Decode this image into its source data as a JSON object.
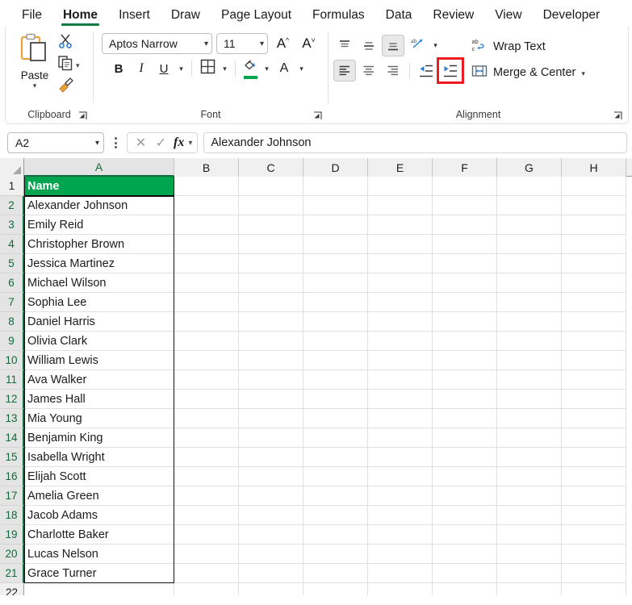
{
  "ribbon": {
    "tabs": [
      {
        "label": "File",
        "active": false
      },
      {
        "label": "Home",
        "active": true
      },
      {
        "label": "Insert",
        "active": false
      },
      {
        "label": "Draw",
        "active": false
      },
      {
        "label": "Page Layout",
        "active": false
      },
      {
        "label": "Formulas",
        "active": false
      },
      {
        "label": "Data",
        "active": false
      },
      {
        "label": "Review",
        "active": false
      },
      {
        "label": "View",
        "active": false
      },
      {
        "label": "Developer",
        "active": false
      }
    ],
    "clipboard": {
      "group_label": "Clipboard",
      "paste_label": "Paste",
      "cut_icon": "scissors-icon",
      "copy_icon": "copy-icon",
      "format_painter_icon": "paintbrush-icon",
      "dialog_launcher_icon": "dialog-launcher-icon"
    },
    "font": {
      "group_label": "Font",
      "font_name": "Aptos Narrow",
      "font_size": "11",
      "grow_font_label": "A",
      "shrink_font_label": "A",
      "bold_label": "B",
      "italic_label": "I",
      "underline_label": "U",
      "borders_icon": "borders-grid-icon",
      "fill_color_icon": "fill-color-icon",
      "fill_color_value": "#00A550",
      "font_color_label": "A",
      "font_color_value": "#c00000",
      "dialog_launcher_icon": "dialog-launcher-icon"
    },
    "alignment": {
      "group_label": "Alignment",
      "top_align": "align-top",
      "middle_align": "align-middle",
      "bottom_align": "align-bottom",
      "orientation_icon": "orientation-icon",
      "align_left": "align-left",
      "align_center": "align-center",
      "align_right": "align-right",
      "decrease_indent": "decrease-indent",
      "increase_indent": "increase-indent",
      "wrap_text_label": "Wrap Text",
      "merge_center_label": "Merge & Center",
      "highlight_color": "#ED1C24",
      "highlighted_button": "increase-indent",
      "selected_buttons": [
        "align-bottom",
        "align-left"
      ],
      "dialog_launcher_icon": "dialog-launcher-icon"
    }
  },
  "formula_bar": {
    "name_box_value": "A2",
    "cancel_icon": "cancel-x-icon",
    "confirm_icon": "confirm-check-icon",
    "fx_label": "fx",
    "formula_value": "Alexander Johnson"
  },
  "grid": {
    "columns": [
      "A",
      "B",
      "C",
      "D",
      "E",
      "F",
      "G",
      "H"
    ],
    "selected_column": "A",
    "rows": [
      "1",
      "2",
      "3",
      "4",
      "5",
      "6",
      "7",
      "8",
      "9",
      "10",
      "11",
      "12",
      "13",
      "14",
      "15",
      "16",
      "17",
      "18",
      "19",
      "20",
      "21",
      "22"
    ],
    "selected_rows": [
      "2",
      "3",
      "4",
      "5",
      "6",
      "7",
      "8",
      "9",
      "10",
      "11",
      "12",
      "13",
      "14",
      "15",
      "16",
      "17",
      "18",
      "19",
      "20",
      "21"
    ],
    "header_cell": {
      "value": "Name",
      "fill": "#00A550",
      "text_color": "#FFFFFF",
      "bold": true
    },
    "column_a_values": [
      "Alexander Johnson",
      "Emily Reid",
      "Christopher Brown",
      "Jessica Martinez",
      "Michael Wilson",
      "Sophia Lee",
      "Daniel Harris",
      "Olivia Clark",
      "William Lewis",
      "Ava Walker",
      "James Hall",
      "Mia Young",
      "Benjamin King",
      "Isabella Wright",
      "Elijah Scott",
      "Amelia Green",
      "Jacob Adams",
      "Charlotte Baker",
      "Lucas Nelson",
      "Grace Turner"
    ],
    "selection_range": "A2:A21"
  }
}
